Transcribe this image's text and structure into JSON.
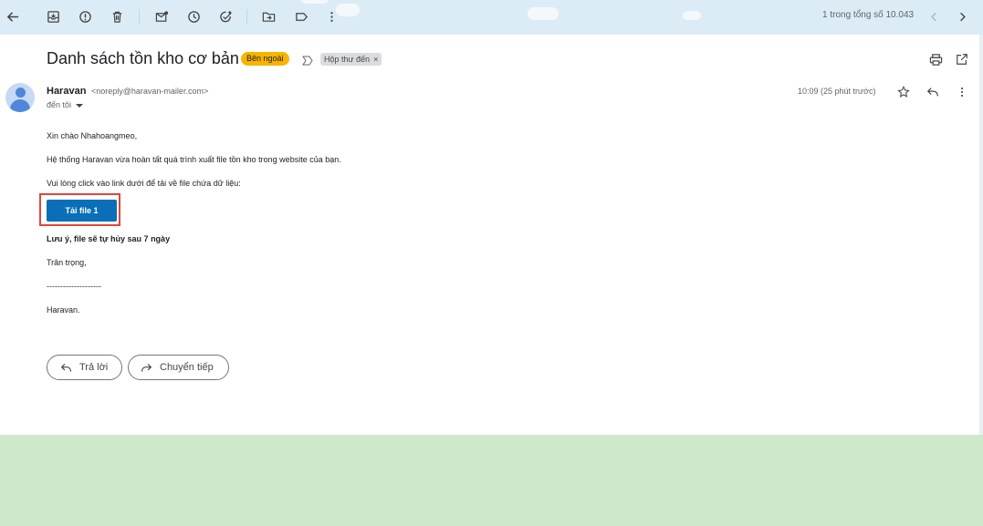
{
  "toolbar": {
    "pager_text": "1 trong tổng số 10.043"
  },
  "email": {
    "subject": "Danh sách tồn kho cơ bản",
    "labels": {
      "external": "Bên ngoài",
      "inbox": "Hộp thư đến",
      "inbox_remove": "×"
    },
    "sender": {
      "name": "Haravan",
      "email": "<noreply@haravan-mailer.com>",
      "to": "đến tôi",
      "time": "10:09 (25 phút trước)"
    },
    "body": {
      "greeting": "Xin chào Nhahoangmeo,",
      "line1": "Hệ thống Haravan vừa hoàn tất quá trình xuất file tồn kho trong website của bạn.",
      "line2": "Vui lòng click vào link dưới để tải về file chứa dữ liệu:",
      "download_label": "Tải file 1",
      "note": "Lưu ý, file sẽ tự hủy sau 7 ngày",
      "regards": "Trân trọng,",
      "divider": "--------------------",
      "signature": "Haravan."
    },
    "actions": {
      "reply_label": "Trả lời",
      "forward_label": "Chuyển tiếp"
    }
  },
  "colors": {
    "accent_button": "#0a6fb8",
    "highlight_box": "#e0463a",
    "external_label": "#f7b500"
  }
}
